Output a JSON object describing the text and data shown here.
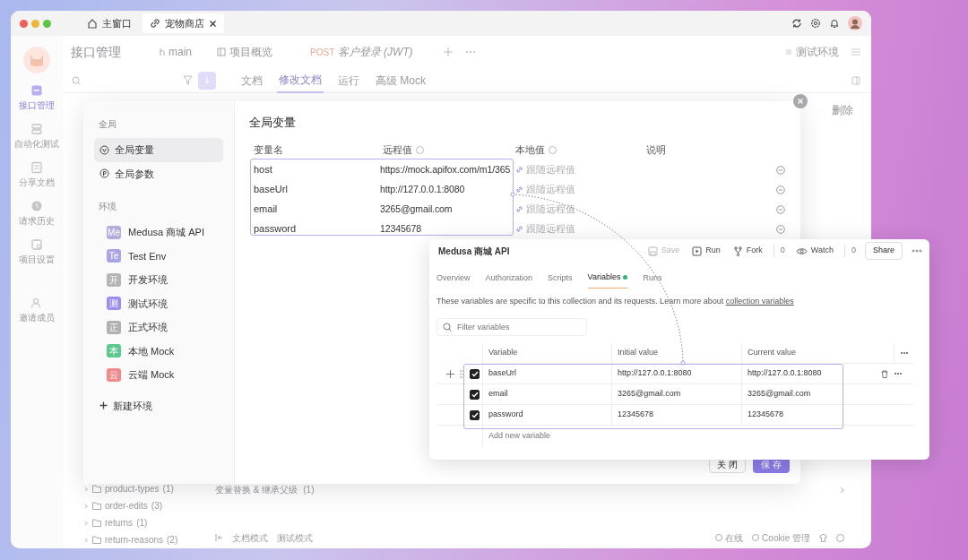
{
  "titlebar": {
    "tabs": [
      {
        "label": "主窗口",
        "selected": false,
        "closable": false
      },
      {
        "label": "宠物商店",
        "selected": true,
        "closable": true
      }
    ]
  },
  "rail": [
    {
      "label": "接口管理",
      "selected": true
    },
    {
      "label": "自动化测试",
      "selected": false
    },
    {
      "label": "分享文档",
      "selected": false
    },
    {
      "label": "请求历史",
      "selected": false
    },
    {
      "label": "项目设置",
      "selected": false
    },
    {
      "label": "邀请成员",
      "selected": false
    }
  ],
  "header": {
    "title": "接口管理",
    "branch": "main",
    "overview": "项目概览",
    "method": "POST",
    "request": "客户登录 (JWT)",
    "environment": "测试环境"
  },
  "doc_tabs": [
    {
      "label": "文档",
      "selected": false
    },
    {
      "label": "修改文档",
      "selected": true
    },
    {
      "label": "运行",
      "selected": false
    },
    {
      "label": "高级 Mock",
      "selected": false
    }
  ],
  "delete_label": "删除",
  "tree": [
    {
      "name": "product-types",
      "count": "(1)"
    },
    {
      "name": "order-edits",
      "count": "(3)"
    },
    {
      "name": "returns",
      "count": "(1)"
    },
    {
      "name": "return-reasons",
      "count": "(2)"
    }
  ],
  "inherit_row": {
    "label": "变量替换 & 继承父级",
    "count": "(1)"
  },
  "footer": {
    "modes": [
      "文档模式",
      "测试模式"
    ],
    "status": "在线",
    "cookie": "Cookie 管理"
  },
  "dialog": {
    "global_heading": "全局",
    "global_items": [
      {
        "label": "全局变量",
        "selected": true
      },
      {
        "label": "全局参数",
        "selected": false
      }
    ],
    "env_heading": "环境",
    "environments": [
      {
        "abbr": "Me",
        "name": "Medusa 商城 API",
        "color": "#b3aedb"
      },
      {
        "abbr": "Te",
        "name": "Test Env",
        "color": "#a9a4e8"
      },
      {
        "abbr": "开",
        "name": "开发环境",
        "color": "#b5b5b5"
      },
      {
        "abbr": "测",
        "name": "测试环境",
        "color": "#9d8df0"
      },
      {
        "abbr": "正",
        "name": "正式环境",
        "color": "#b0b0b0"
      },
      {
        "abbr": "本",
        "name": "本地 Mock",
        "color": "#5cc98f"
      },
      {
        "abbr": "云",
        "name": "云端 Mock",
        "color": "#f08a8a"
      }
    ],
    "new_env": "新建环境",
    "title": "全局变量",
    "columns": [
      {
        "label": "变量名",
        "help": false
      },
      {
        "label": "远程值",
        "help": true
      },
      {
        "label": "本地值",
        "help": true
      },
      {
        "label": "说明",
        "help": false
      }
    ],
    "rows": [
      {
        "name": "host",
        "remote": "https://mock.apifox.com/m1/365",
        "local_placeholder": "跟随远程值"
      },
      {
        "name": "baseUrl",
        "remote": "http://127.0.0.1:8080",
        "local_placeholder": "跟随远程值"
      },
      {
        "name": "email",
        "remote": "3265@gmail.com",
        "local_placeholder": "跟随远程值"
      },
      {
        "name": "password",
        "remote": "12345678",
        "local_placeholder": "跟随远程值"
      }
    ],
    "close_button": "关 闭",
    "save_button": "保 存"
  },
  "postman": {
    "title": "Medusa 商城 API",
    "actions": [
      {
        "label": "Save",
        "disabled": true
      },
      {
        "label": "Run",
        "disabled": false
      },
      {
        "label": "Fork",
        "disabled": false,
        "count": "0"
      },
      {
        "label": "Watch",
        "disabled": false,
        "count": "0"
      }
    ],
    "share": "Share",
    "tabs": [
      {
        "label": "Overview",
        "selected": false,
        "dot": false
      },
      {
        "label": "Authorization",
        "selected": false,
        "dot": false
      },
      {
        "label": "Scripts",
        "selected": false,
        "dot": false
      },
      {
        "label": "Variables",
        "selected": true,
        "dot": true
      },
      {
        "label": "Runs",
        "selected": false,
        "dot": false
      }
    ],
    "description": "These variables are specific to this collection and its requests. Learn more about ",
    "description_link": "collection variables",
    "filter_placeholder": "Filter variables",
    "columns": [
      "Variable",
      "Initial value",
      "Current value"
    ],
    "rows": [
      {
        "name": "baseUrl",
        "initial": "http://127.0.0.1:8080",
        "current": "http://127.0.0.1:8080",
        "checked": true
      },
      {
        "name": "email",
        "initial": "3265@gmail.com",
        "current": "3265@gmail.com",
        "checked": true
      },
      {
        "name": "password",
        "initial": "12345678",
        "current": "12345678",
        "checked": true
      }
    ],
    "add_placeholder": "Add new variable"
  }
}
